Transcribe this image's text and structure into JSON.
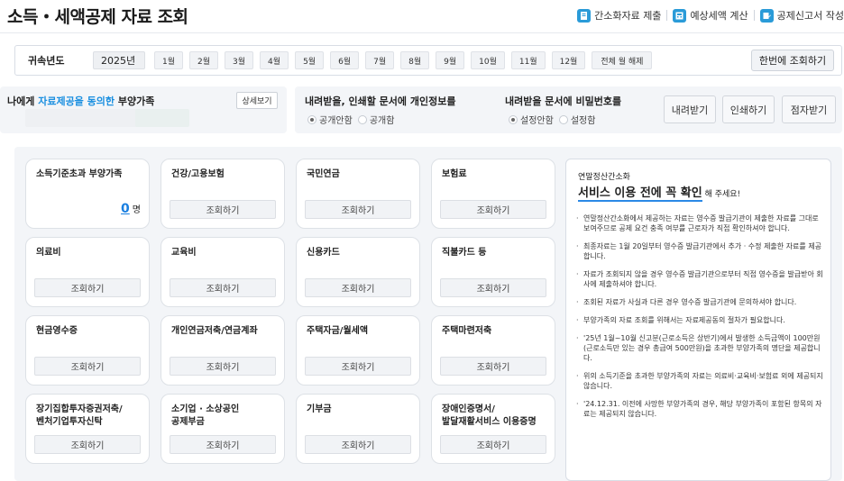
{
  "header": {
    "title": "소득・세액공제 자료 조회",
    "actions": [
      {
        "label": "간소화자료 제출",
        "icon": "document-submit-icon"
      },
      {
        "label": "예상세액 계산",
        "icon": "calculator-icon"
      },
      {
        "label": "공제신고서 작성",
        "icon": "form-edit-icon"
      }
    ]
  },
  "year_bar": {
    "label": "귀속년도",
    "year": "2025년",
    "months": [
      "1월",
      "2월",
      "3월",
      "4월",
      "5월",
      "6월",
      "7월",
      "8월",
      "9월",
      "10월",
      "11월",
      "12월"
    ],
    "clear_all": "전체 월 해제",
    "query_all": "한번에 조회하기"
  },
  "dependents": {
    "title_prefix": "나에게 ",
    "title_highlight": "자료제공을 동의한",
    "title_suffix": " 부양가족",
    "detail_button": "상세보기"
  },
  "privacy_option": {
    "title": "내려받을, 인쇄할 문서에 개인정보를",
    "options": [
      "공개안함",
      "공개함"
    ],
    "selected": "공개안함"
  },
  "password_option": {
    "title": "내려받을 문서에 비밀번호를",
    "options": [
      "설정안함",
      "설정함"
    ],
    "selected": "설정안함"
  },
  "doc_actions": [
    "내려받기",
    "인쇄하기",
    "점자받기"
  ],
  "cards": [
    {
      "title": "소득기준초과 부양가족",
      "count": "0",
      "unit": "명"
    },
    {
      "title": "건강/고용보험",
      "button": "조회하기"
    },
    {
      "title": "국민연금",
      "button": "조회하기"
    },
    {
      "title": "보험료",
      "button": "조회하기"
    },
    {
      "title": "의료비",
      "button": "조회하기"
    },
    {
      "title": "교육비",
      "button": "조회하기"
    },
    {
      "title": "신용카드",
      "button": "조회하기"
    },
    {
      "title": "직불카드 등",
      "button": "조회하기"
    },
    {
      "title": "현금영수증",
      "button": "조회하기"
    },
    {
      "title": "개인연금저축/연금계좌",
      "button": "조회하기"
    },
    {
      "title": "주택자금/월세액",
      "button": "조회하기"
    },
    {
      "title": "주택마련저축",
      "button": "조회하기"
    },
    {
      "title": "장기집합투자증권저축/\n벤처기업투자신탁",
      "button": "조회하기"
    },
    {
      "title": "소기업 · 소상공인\n공제부금",
      "button": "조회하기"
    },
    {
      "title": "기부금",
      "button": "조회하기"
    },
    {
      "title": "장애인증명서/\n발달재활서비스 이용증명",
      "button": "조회하기"
    }
  ],
  "notice": {
    "subtitle": "연말정산간소화",
    "heading": "서비스 이용 전에 꼭 확인",
    "heading_suffix": " 해 주세요!",
    "items": [
      "연말정산간소화에서 제공하는 자료는 영수증 발급기관이 제출한 자료를 그대로 보여주므로 공제 요건 충족 여부를 근로자가 직접 확인하셔야 합니다.",
      "최종자료는 1월 20일부터 영수증 발급기관에서 추가 · 수정 제출한 자료를 제공합니다.",
      "자료가 조회되지 않을 경우 영수증 발급기관으로부터 직접 영수증을 발급받아 회사에 제출하셔야 합니다.",
      "조회된 자료가 사실과 다른 경우 영수증 발급기관에 문의하셔야 합니다.",
      "부양가족의 자료 조회를 위해서는 자료제공동의 절차가 필요합니다.",
      "'25년 1월~10월 신고분(근로소득은 상반기)에서 발생한 소득금액이 100만원(근로소득만 있는 경우 총급여 500만원)을 초과한 부양가족의 명단을 제공합니다.",
      "위의 소득기준을 초과한 부양가족의 자료는 의료비·교육비·보험료 외에 제공되지 않습니다.",
      "'24.12.31. 이전에 사망한 부양가족의 경우, 해당 부양가족이 포함된 항목의 자료는 제공되지 않습니다."
    ]
  },
  "colors": {
    "accent": "#1a8fe0",
    "panel_bg": "#f3f5f8"
  }
}
